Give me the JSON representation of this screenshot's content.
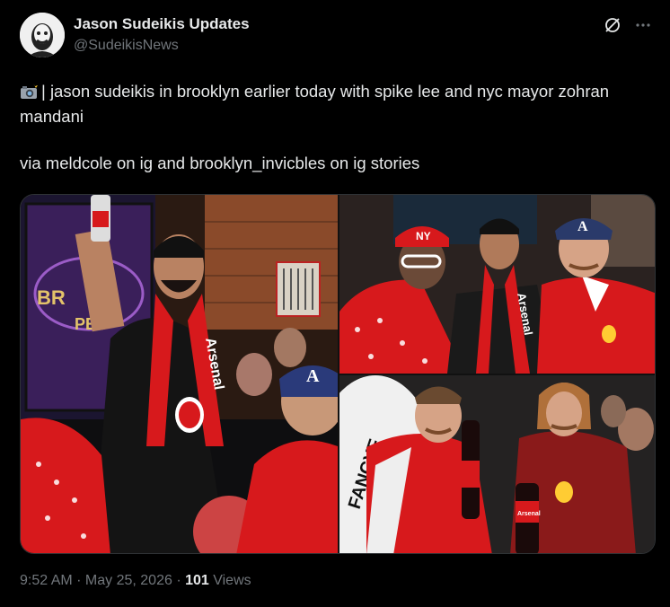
{
  "author": {
    "name": "Jason Sudeikis Updates",
    "handle": "@SudeikisNews"
  },
  "icons": {
    "grok": "grok-icon",
    "more": "more-icon",
    "camera": "camera-flash-emoji"
  },
  "tweet": {
    "line1": "| jason sudeikis in brooklyn earlier today with spike lee and nyc mayor zohran mandani",
    "line2": "via meldcole on ig and brooklyn_invicbles on ig stories"
  },
  "photos": {
    "photo1_sign_a": "BR",
    "photo1_sign_b": "PE",
    "photo1_scarf": "Arsenal",
    "photo2_scarf": "Arsenal",
    "photo2_cap": "NY",
    "photo3_sign": "FANCYF",
    "photo3_bottle": "Arsenal"
  },
  "meta": {
    "time": "9:52 AM",
    "sep1": " · ",
    "date": "May 25, 2026",
    "sep2": " · ",
    "views_count": "101",
    "views_label": " Views"
  },
  "colors": {
    "arsenal_red": "#d7191c",
    "muted": "#71767b",
    "text": "#e7e9ea"
  }
}
